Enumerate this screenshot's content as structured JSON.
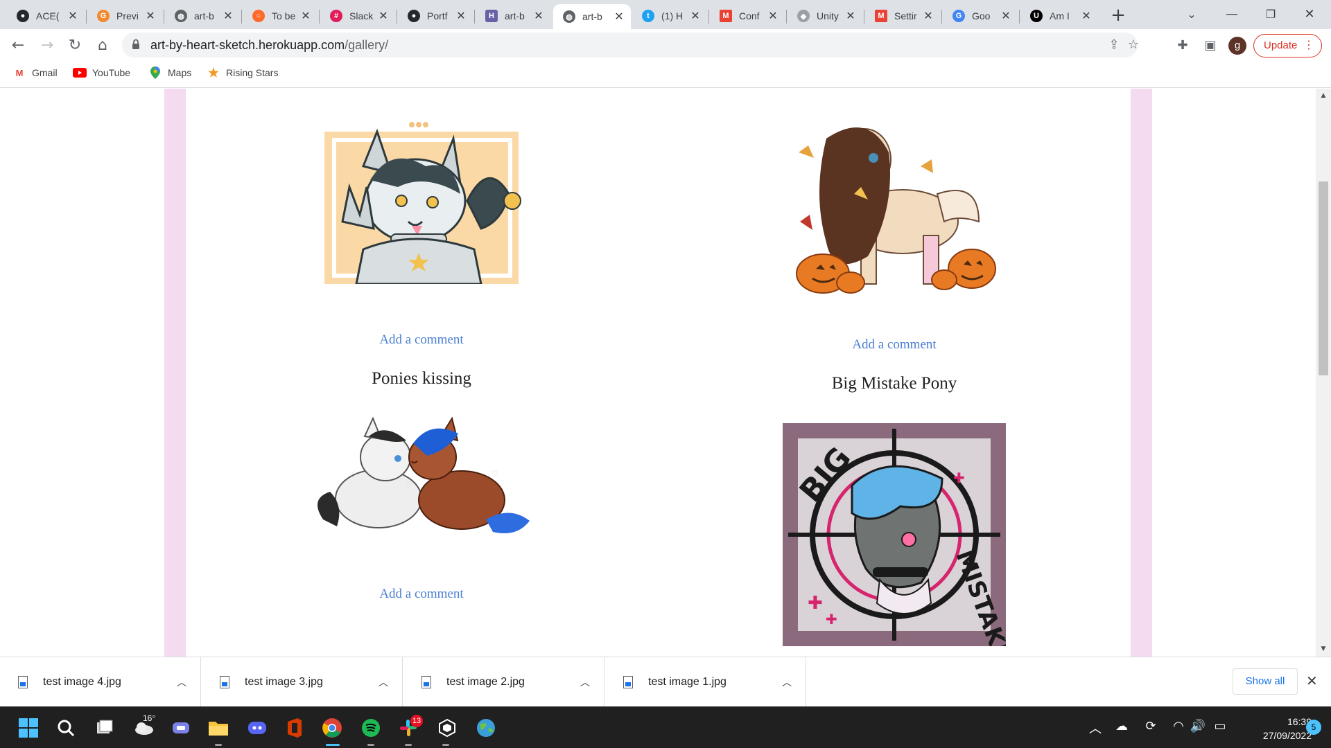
{
  "browser": {
    "tabs": [
      {
        "title": "ACE(",
        "icon": "github-icon",
        "color": "#24292f"
      },
      {
        "title": "Previ",
        "icon": "g-logo-icon",
        "color": "#f28b30"
      },
      {
        "title": "art-b",
        "icon": "globe-icon",
        "color": "#5f6368"
      },
      {
        "title": "To be",
        "icon": "circle-o-icon",
        "color": "#ff6a2b"
      },
      {
        "title": "Slack",
        "icon": "slack-icon",
        "color": "#e01e5a"
      },
      {
        "title": "Portf",
        "icon": "github-icon",
        "color": "#24292f"
      },
      {
        "title": "art-b",
        "icon": "heroku-icon",
        "color": "#6762a6"
      },
      {
        "title": "art-b",
        "icon": "globe-icon",
        "color": "#5f6368"
      },
      {
        "title": "(1) H",
        "icon": "twitter-icon",
        "color": "#1da1f2"
      },
      {
        "title": "Conf",
        "icon": "gmail-icon",
        "color": "#ea4335"
      },
      {
        "title": "Unity",
        "icon": "unity-icon",
        "color": "#9aa0a6"
      },
      {
        "title": "Settir",
        "icon": "gmail-icon",
        "color": "#ea4335"
      },
      {
        "title": "Goo",
        "icon": "google-icon",
        "color": "#4285f4"
      },
      {
        "title": "Am I",
        "icon": "unity-u-icon",
        "color": "#000000"
      }
    ],
    "active_tab": 7,
    "url_host": "art-by-heart-sketch.herokuapp.com",
    "url_path": "/gallery/",
    "profile_initial": "g",
    "update_label": "Update",
    "bookmarks": [
      {
        "label": "Gmail",
        "icon": "gmail-icon"
      },
      {
        "label": "YouTube",
        "icon": "youtube-icon"
      },
      {
        "label": "Maps",
        "icon": "maps-icon"
      },
      {
        "label": "Rising Stars",
        "icon": "star-icon"
      }
    ]
  },
  "gallery": {
    "items": [
      {
        "title": "",
        "comment_label": "Add a comment",
        "art": "wolf-peace-sign-art"
      },
      {
        "title": "",
        "comment_label": "Add a comment",
        "art": "autumn-pony-pumpkins-art"
      },
      {
        "title": "Ponies kissing",
        "comment_label": "Add a comment",
        "art": "ponies-kissing-art"
      },
      {
        "title": "Big Mistake Pony",
        "comment_label": "",
        "art": "big-mistake-pony-art"
      }
    ],
    "big_mistake_text_top": "BIG",
    "big_mistake_text_right": "MISTAKE"
  },
  "downloads": {
    "files": [
      "test image 4.jpg",
      "test image 3.jpg",
      "test image 2.jpg",
      "test image 1.jpg"
    ],
    "show_all_label": "Show all"
  },
  "taskbar": {
    "weather_temp": "16°",
    "slack_badge": "13",
    "time": "16:39",
    "date": "27/09/2022",
    "notification_count": "5"
  },
  "colors": {
    "link": "#4a7fd4",
    "band": "#f4dbf0",
    "update": "#d93025"
  }
}
